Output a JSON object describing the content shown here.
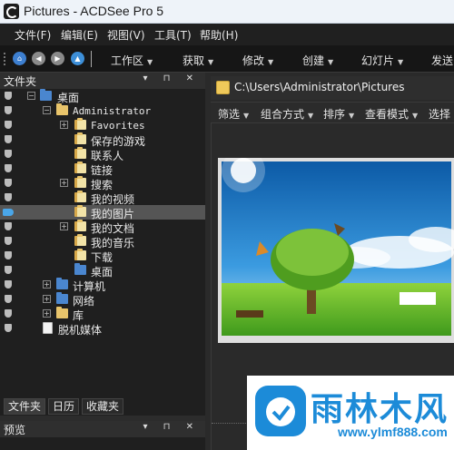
{
  "titlebar": {
    "title": "Pictures - ACDSee Pro 5"
  },
  "menubar": {
    "items": [
      "文件(F)",
      "编辑(E)",
      "视图(V)",
      "工具(T)",
      "帮助(H)"
    ]
  },
  "toolbar": {
    "items": [
      "工作区",
      "获取",
      "修改",
      "创建",
      "幻灯片",
      "发送"
    ]
  },
  "folder_panel": {
    "title": "文件夹",
    "header_icons": "▾ ⊓ ✕",
    "tree": [
      {
        "label": "桌面",
        "expander": "−",
        "icon": "desktop"
      },
      {
        "label": "Administrator",
        "expander": "−",
        "icon": "user"
      },
      {
        "label": "Favorites",
        "expander": "+",
        "icon": "folder"
      },
      {
        "label": "保存的游戏",
        "expander": "",
        "icon": "folder"
      },
      {
        "label": "联系人",
        "expander": "",
        "icon": "folder"
      },
      {
        "label": "链接",
        "expander": "",
        "icon": "folder"
      },
      {
        "label": "搜索",
        "expander": "+",
        "icon": "folder"
      },
      {
        "label": "我的视频",
        "expander": "",
        "icon": "folder"
      },
      {
        "label": "我的图片",
        "expander": "",
        "icon": "folder",
        "selected": true
      },
      {
        "label": "我的文档",
        "expander": "+",
        "icon": "folder"
      },
      {
        "label": "我的音乐",
        "expander": "",
        "icon": "folder"
      },
      {
        "label": "下载",
        "expander": "",
        "icon": "folder"
      },
      {
        "label": "桌面",
        "expander": "",
        "icon": "folder"
      },
      {
        "label": "计算机",
        "expander": "+",
        "icon": "computer"
      },
      {
        "label": "网络",
        "expander": "+",
        "icon": "network"
      },
      {
        "label": "库",
        "expander": "+",
        "icon": "library"
      },
      {
        "label": "脱机媒体",
        "expander": "",
        "icon": "file"
      }
    ],
    "tabs": [
      "文件夹",
      "日历",
      "收藏夹"
    ]
  },
  "preview_panel": {
    "title": "预览",
    "header_icons": "▾ ⊓ ✕"
  },
  "path_bar": {
    "path": "C:\\Users\\Administrator\\Pictures"
  },
  "filter_bar": {
    "items": [
      "筛选",
      "组合方式",
      "排序",
      "查看模式",
      "选择"
    ]
  },
  "watermark": {
    "name": "雨林木风",
    "url": "www.ylmf888.com"
  },
  "colors": {
    "accent": "#1c8bd8",
    "selection": "#555555",
    "panel": "#1f1f1f"
  }
}
